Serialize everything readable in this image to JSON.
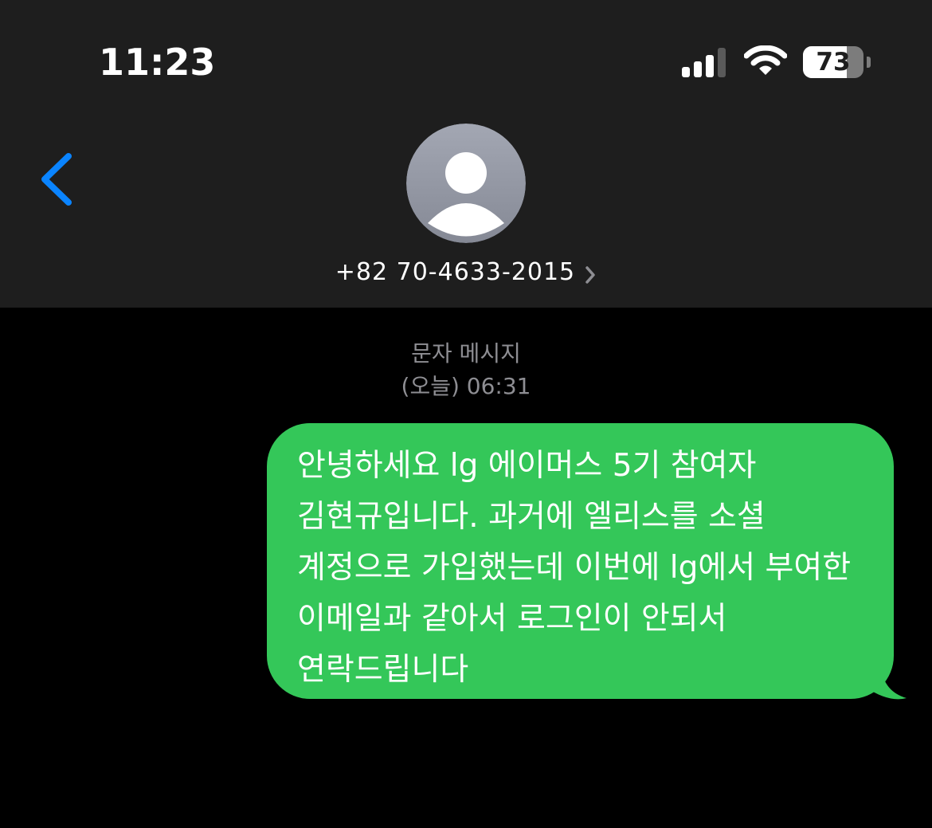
{
  "status_bar": {
    "time": "11:23",
    "battery_level": "73",
    "battery_fraction": 0.73,
    "icons": [
      "signal-icon",
      "wifi-icon",
      "battery-icon"
    ]
  },
  "header": {
    "back_icon": "chevron-left-icon",
    "avatar_icon": "person-avatar-icon",
    "contact": "+82 70-4633-2015",
    "contact_chevron_icon": "chevron-right-icon"
  },
  "conversation": {
    "message_kind": "문자 메시지",
    "timestamp": "(오늘) 06:31",
    "messages": [
      {
        "direction": "outgoing",
        "text": "안녕하세요 lg 에이머스 5기 참여자 김현규입니다. 과거에 엘리스를 소셜 계정으로 가입했는데 이번에 lg에서 부여한 이메일과 같아서 로그인이 안되서 연락드립니다"
      }
    ]
  },
  "colors": {
    "header_background": "#1e1e1e",
    "screen_background": "#000000",
    "bubble_green": "#34c759",
    "accent_blue": "#0a84ff",
    "meta_gray": "#8e8e93"
  }
}
